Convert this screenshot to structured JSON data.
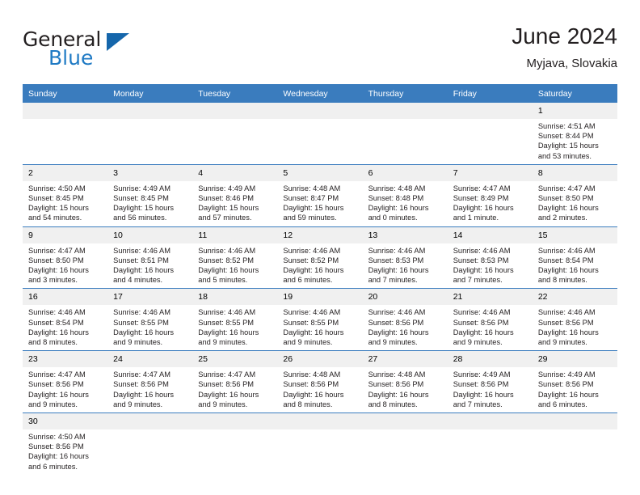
{
  "brand": {
    "name_part1": "General",
    "name_part2": "Blue",
    "logo_icon": "triangle-flag-icon"
  },
  "header": {
    "title": "June 2024",
    "location": "Myjava, Slovakia"
  },
  "calendar": {
    "weekday_headers": [
      "Sunday",
      "Monday",
      "Tuesday",
      "Wednesday",
      "Thursday",
      "Friday",
      "Saturday"
    ],
    "accent_color": "#3a7cbe",
    "daynum_band_color": "#f0f0f0",
    "weeks": [
      [
        {
          "day": "",
          "sunrise": "",
          "sunset": "",
          "daylight_line1": "",
          "daylight_line2": ""
        },
        {
          "day": "",
          "sunrise": "",
          "sunset": "",
          "daylight_line1": "",
          "daylight_line2": ""
        },
        {
          "day": "",
          "sunrise": "",
          "sunset": "",
          "daylight_line1": "",
          "daylight_line2": ""
        },
        {
          "day": "",
          "sunrise": "",
          "sunset": "",
          "daylight_line1": "",
          "daylight_line2": ""
        },
        {
          "day": "",
          "sunrise": "",
          "sunset": "",
          "daylight_line1": "",
          "daylight_line2": ""
        },
        {
          "day": "",
          "sunrise": "",
          "sunset": "",
          "daylight_line1": "",
          "daylight_line2": ""
        },
        {
          "day": "1",
          "sunrise": "Sunrise: 4:51 AM",
          "sunset": "Sunset: 8:44 PM",
          "daylight_line1": "Daylight: 15 hours",
          "daylight_line2": "and 53 minutes."
        }
      ],
      [
        {
          "day": "2",
          "sunrise": "Sunrise: 4:50 AM",
          "sunset": "Sunset: 8:45 PM",
          "daylight_line1": "Daylight: 15 hours",
          "daylight_line2": "and 54 minutes."
        },
        {
          "day": "3",
          "sunrise": "Sunrise: 4:49 AM",
          "sunset": "Sunset: 8:45 PM",
          "daylight_line1": "Daylight: 15 hours",
          "daylight_line2": "and 56 minutes."
        },
        {
          "day": "4",
          "sunrise": "Sunrise: 4:49 AM",
          "sunset": "Sunset: 8:46 PM",
          "daylight_line1": "Daylight: 15 hours",
          "daylight_line2": "and 57 minutes."
        },
        {
          "day": "5",
          "sunrise": "Sunrise: 4:48 AM",
          "sunset": "Sunset: 8:47 PM",
          "daylight_line1": "Daylight: 15 hours",
          "daylight_line2": "and 59 minutes."
        },
        {
          "day": "6",
          "sunrise": "Sunrise: 4:48 AM",
          "sunset": "Sunset: 8:48 PM",
          "daylight_line1": "Daylight: 16 hours",
          "daylight_line2": "and 0 minutes."
        },
        {
          "day": "7",
          "sunrise": "Sunrise: 4:47 AM",
          "sunset": "Sunset: 8:49 PM",
          "daylight_line1": "Daylight: 16 hours",
          "daylight_line2": "and 1 minute."
        },
        {
          "day": "8",
          "sunrise": "Sunrise: 4:47 AM",
          "sunset": "Sunset: 8:50 PM",
          "daylight_line1": "Daylight: 16 hours",
          "daylight_line2": "and 2 minutes."
        }
      ],
      [
        {
          "day": "9",
          "sunrise": "Sunrise: 4:47 AM",
          "sunset": "Sunset: 8:50 PM",
          "daylight_line1": "Daylight: 16 hours",
          "daylight_line2": "and 3 minutes."
        },
        {
          "day": "10",
          "sunrise": "Sunrise: 4:46 AM",
          "sunset": "Sunset: 8:51 PM",
          "daylight_line1": "Daylight: 16 hours",
          "daylight_line2": "and 4 minutes."
        },
        {
          "day": "11",
          "sunrise": "Sunrise: 4:46 AM",
          "sunset": "Sunset: 8:52 PM",
          "daylight_line1": "Daylight: 16 hours",
          "daylight_line2": "and 5 minutes."
        },
        {
          "day": "12",
          "sunrise": "Sunrise: 4:46 AM",
          "sunset": "Sunset: 8:52 PM",
          "daylight_line1": "Daylight: 16 hours",
          "daylight_line2": "and 6 minutes."
        },
        {
          "day": "13",
          "sunrise": "Sunrise: 4:46 AM",
          "sunset": "Sunset: 8:53 PM",
          "daylight_line1": "Daylight: 16 hours",
          "daylight_line2": "and 7 minutes."
        },
        {
          "day": "14",
          "sunrise": "Sunrise: 4:46 AM",
          "sunset": "Sunset: 8:53 PM",
          "daylight_line1": "Daylight: 16 hours",
          "daylight_line2": "and 7 minutes."
        },
        {
          "day": "15",
          "sunrise": "Sunrise: 4:46 AM",
          "sunset": "Sunset: 8:54 PM",
          "daylight_line1": "Daylight: 16 hours",
          "daylight_line2": "and 8 minutes."
        }
      ],
      [
        {
          "day": "16",
          "sunrise": "Sunrise: 4:46 AM",
          "sunset": "Sunset: 8:54 PM",
          "daylight_line1": "Daylight: 16 hours",
          "daylight_line2": "and 8 minutes."
        },
        {
          "day": "17",
          "sunrise": "Sunrise: 4:46 AM",
          "sunset": "Sunset: 8:55 PM",
          "daylight_line1": "Daylight: 16 hours",
          "daylight_line2": "and 9 minutes."
        },
        {
          "day": "18",
          "sunrise": "Sunrise: 4:46 AM",
          "sunset": "Sunset: 8:55 PM",
          "daylight_line1": "Daylight: 16 hours",
          "daylight_line2": "and 9 minutes."
        },
        {
          "day": "19",
          "sunrise": "Sunrise: 4:46 AM",
          "sunset": "Sunset: 8:55 PM",
          "daylight_line1": "Daylight: 16 hours",
          "daylight_line2": "and 9 minutes."
        },
        {
          "day": "20",
          "sunrise": "Sunrise: 4:46 AM",
          "sunset": "Sunset: 8:56 PM",
          "daylight_line1": "Daylight: 16 hours",
          "daylight_line2": "and 9 minutes."
        },
        {
          "day": "21",
          "sunrise": "Sunrise: 4:46 AM",
          "sunset": "Sunset: 8:56 PM",
          "daylight_line1": "Daylight: 16 hours",
          "daylight_line2": "and 9 minutes."
        },
        {
          "day": "22",
          "sunrise": "Sunrise: 4:46 AM",
          "sunset": "Sunset: 8:56 PM",
          "daylight_line1": "Daylight: 16 hours",
          "daylight_line2": "and 9 minutes."
        }
      ],
      [
        {
          "day": "23",
          "sunrise": "Sunrise: 4:47 AM",
          "sunset": "Sunset: 8:56 PM",
          "daylight_line1": "Daylight: 16 hours",
          "daylight_line2": "and 9 minutes."
        },
        {
          "day": "24",
          "sunrise": "Sunrise: 4:47 AM",
          "sunset": "Sunset: 8:56 PM",
          "daylight_line1": "Daylight: 16 hours",
          "daylight_line2": "and 9 minutes."
        },
        {
          "day": "25",
          "sunrise": "Sunrise: 4:47 AM",
          "sunset": "Sunset: 8:56 PM",
          "daylight_line1": "Daylight: 16 hours",
          "daylight_line2": "and 9 minutes."
        },
        {
          "day": "26",
          "sunrise": "Sunrise: 4:48 AM",
          "sunset": "Sunset: 8:56 PM",
          "daylight_line1": "Daylight: 16 hours",
          "daylight_line2": "and 8 minutes."
        },
        {
          "day": "27",
          "sunrise": "Sunrise: 4:48 AM",
          "sunset": "Sunset: 8:56 PM",
          "daylight_line1": "Daylight: 16 hours",
          "daylight_line2": "and 8 minutes."
        },
        {
          "day": "28",
          "sunrise": "Sunrise: 4:49 AM",
          "sunset": "Sunset: 8:56 PM",
          "daylight_line1": "Daylight: 16 hours",
          "daylight_line2": "and 7 minutes."
        },
        {
          "day": "29",
          "sunrise": "Sunrise: 4:49 AM",
          "sunset": "Sunset: 8:56 PM",
          "daylight_line1": "Daylight: 16 hours",
          "daylight_line2": "and 6 minutes."
        }
      ],
      [
        {
          "day": "30",
          "sunrise": "Sunrise: 4:50 AM",
          "sunset": "Sunset: 8:56 PM",
          "daylight_line1": "Daylight: 16 hours",
          "daylight_line2": "and 6 minutes."
        },
        {
          "day": "",
          "sunrise": "",
          "sunset": "",
          "daylight_line1": "",
          "daylight_line2": ""
        },
        {
          "day": "",
          "sunrise": "",
          "sunset": "",
          "daylight_line1": "",
          "daylight_line2": ""
        },
        {
          "day": "",
          "sunrise": "",
          "sunset": "",
          "daylight_line1": "",
          "daylight_line2": ""
        },
        {
          "day": "",
          "sunrise": "",
          "sunset": "",
          "daylight_line1": "",
          "daylight_line2": ""
        },
        {
          "day": "",
          "sunrise": "",
          "sunset": "",
          "daylight_line1": "",
          "daylight_line2": ""
        },
        {
          "day": "",
          "sunrise": "",
          "sunset": "",
          "daylight_line1": "",
          "daylight_line2": ""
        }
      ]
    ]
  }
}
